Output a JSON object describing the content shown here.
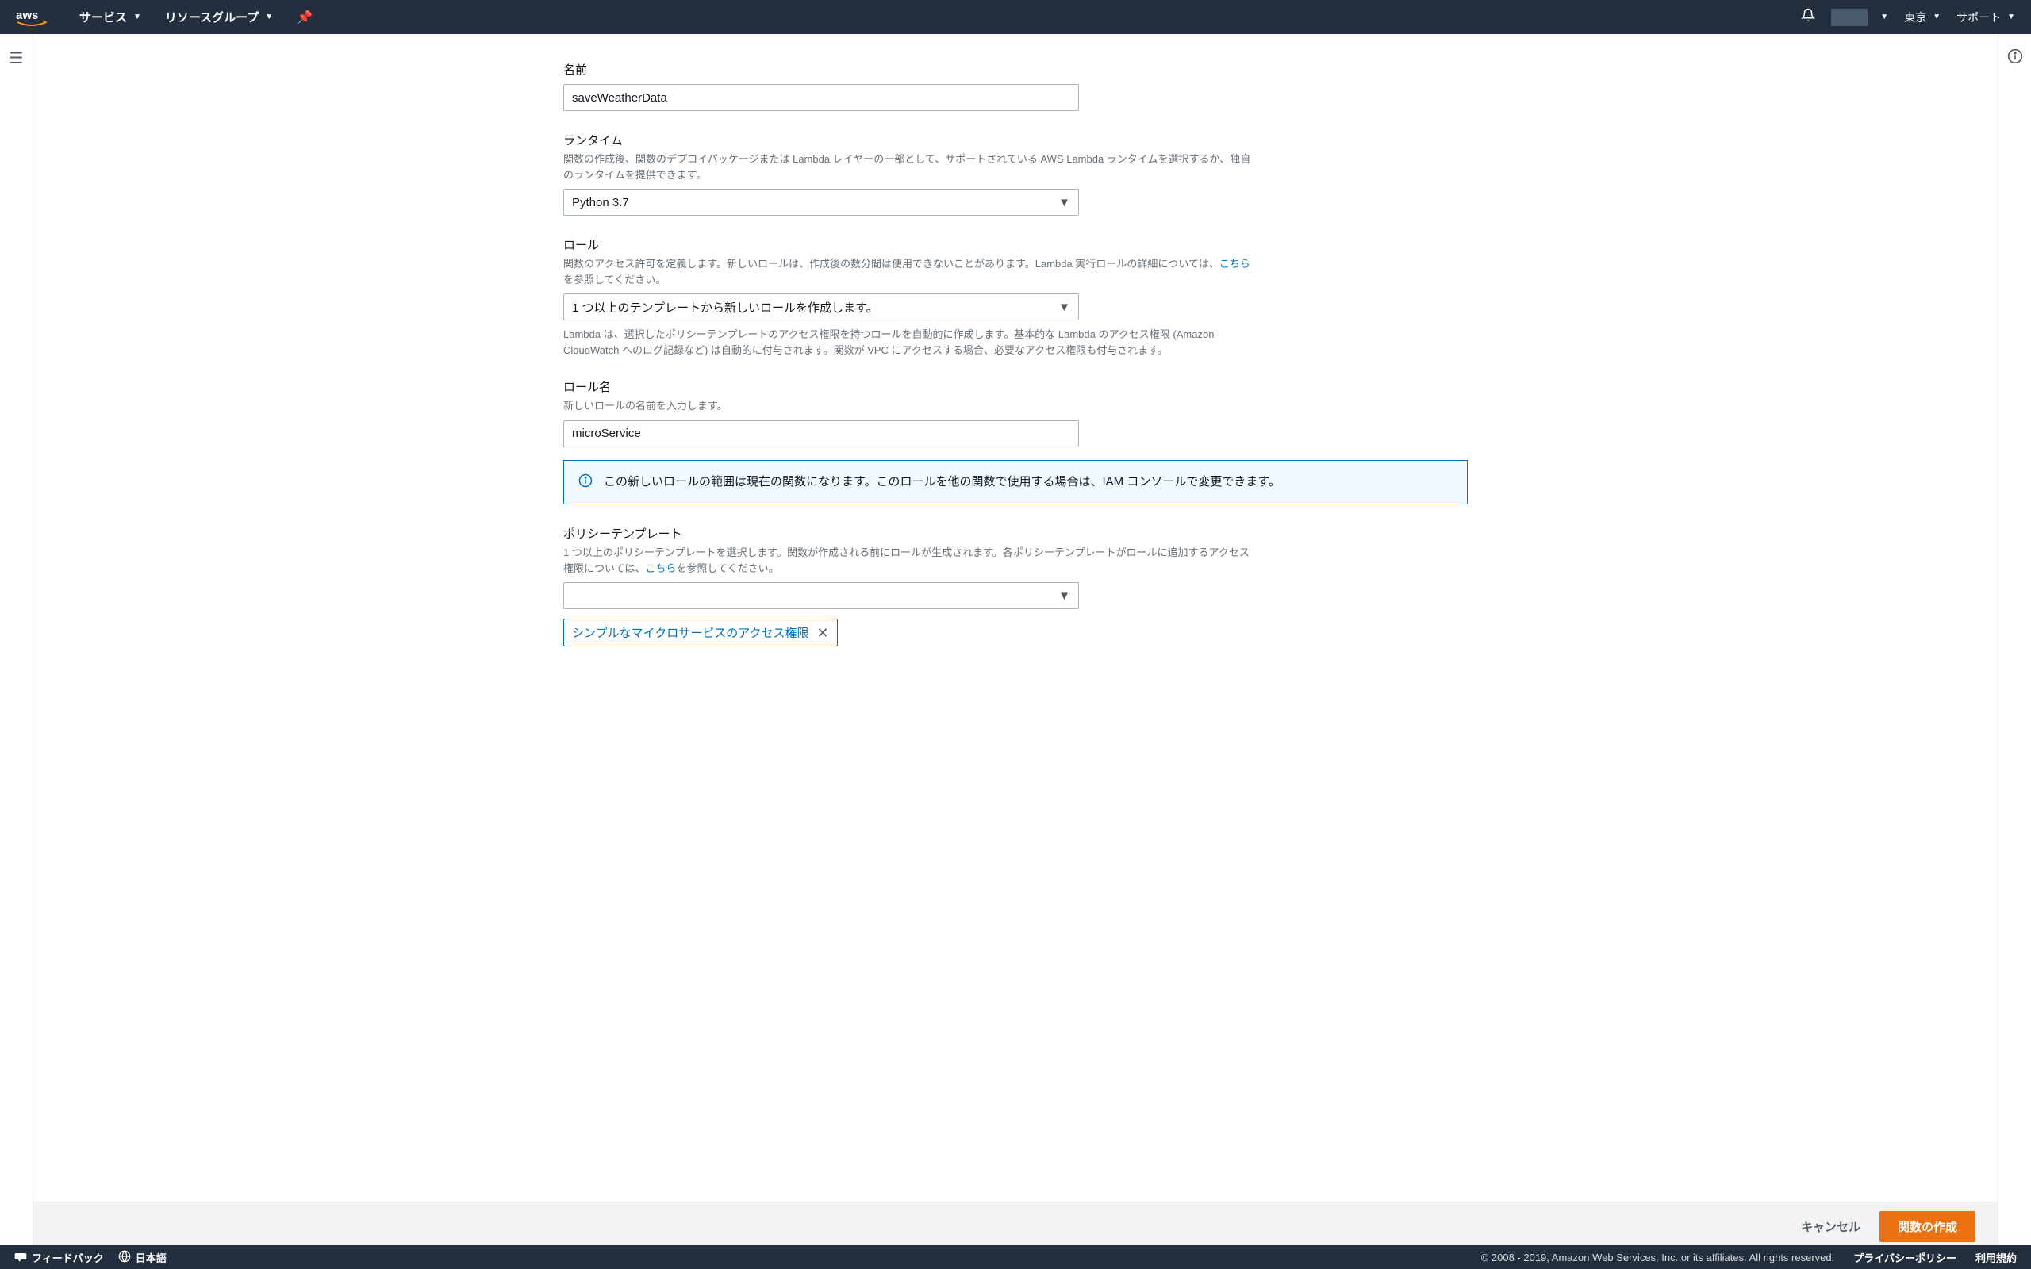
{
  "nav": {
    "services_label": "サービス",
    "resource_groups_label": "リソースグループ",
    "region_label": "東京",
    "support_label": "サポート"
  },
  "form": {
    "name": {
      "label": "名前",
      "value": "saveWeatherData"
    },
    "runtime": {
      "label": "ランタイム",
      "help": "関数の作成後、関数のデプロイパッケージまたは Lambda レイヤーの一部として、サポートされている AWS Lambda ランタイムを選択するか、独自のランタイムを提供できます。",
      "value": "Python 3.7"
    },
    "role": {
      "label": "ロール",
      "help_prefix": "関数のアクセス許可を定義します。新しいロールは、作成後の数分間は使用できないことがあります。Lambda 実行ロールの詳細については、",
      "help_link": "こちら",
      "help_suffix": "を参照してください。",
      "value": "1 つ以上のテンプレートから新しいロールを作成します。",
      "after_help": "Lambda は、選択したポリシーテンプレートのアクセス権限を持つロールを自動的に作成します。基本的な Lambda のアクセス権限 (Amazon CloudWatch へのログ記録など) は自動的に付与されます。関数が VPC にアクセスする場合、必要なアクセス権限も付与されます。"
    },
    "role_name": {
      "label": "ロール名",
      "help": "新しいロールの名前を入力します。",
      "value": "microService"
    },
    "info_box": {
      "message": "この新しいロールの範囲は現在の関数になります。このロールを他の関数で使用する場合は、IAM コンソールで変更できます。"
    },
    "policy_templates": {
      "label": "ポリシーテンプレート",
      "help_prefix": "1 つ以上のポリシーテンプレートを選択します。関数が作成される前にロールが生成されます。各ポリシーテンプレートがロールに追加するアクセス権限については、",
      "help_link": "こちら",
      "help_suffix": "を参照してください。",
      "value": "",
      "token": "シンプルなマイクロサービスのアクセス権限"
    }
  },
  "actions": {
    "cancel": "キャンセル",
    "create": "関数の作成"
  },
  "footer": {
    "feedback": "フィードバック",
    "language": "日本語",
    "copyright": "© 2008 - 2019, Amazon Web Services, Inc. or its affiliates. All rights reserved.",
    "privacy": "プライバシーポリシー",
    "terms": "利用規約"
  }
}
